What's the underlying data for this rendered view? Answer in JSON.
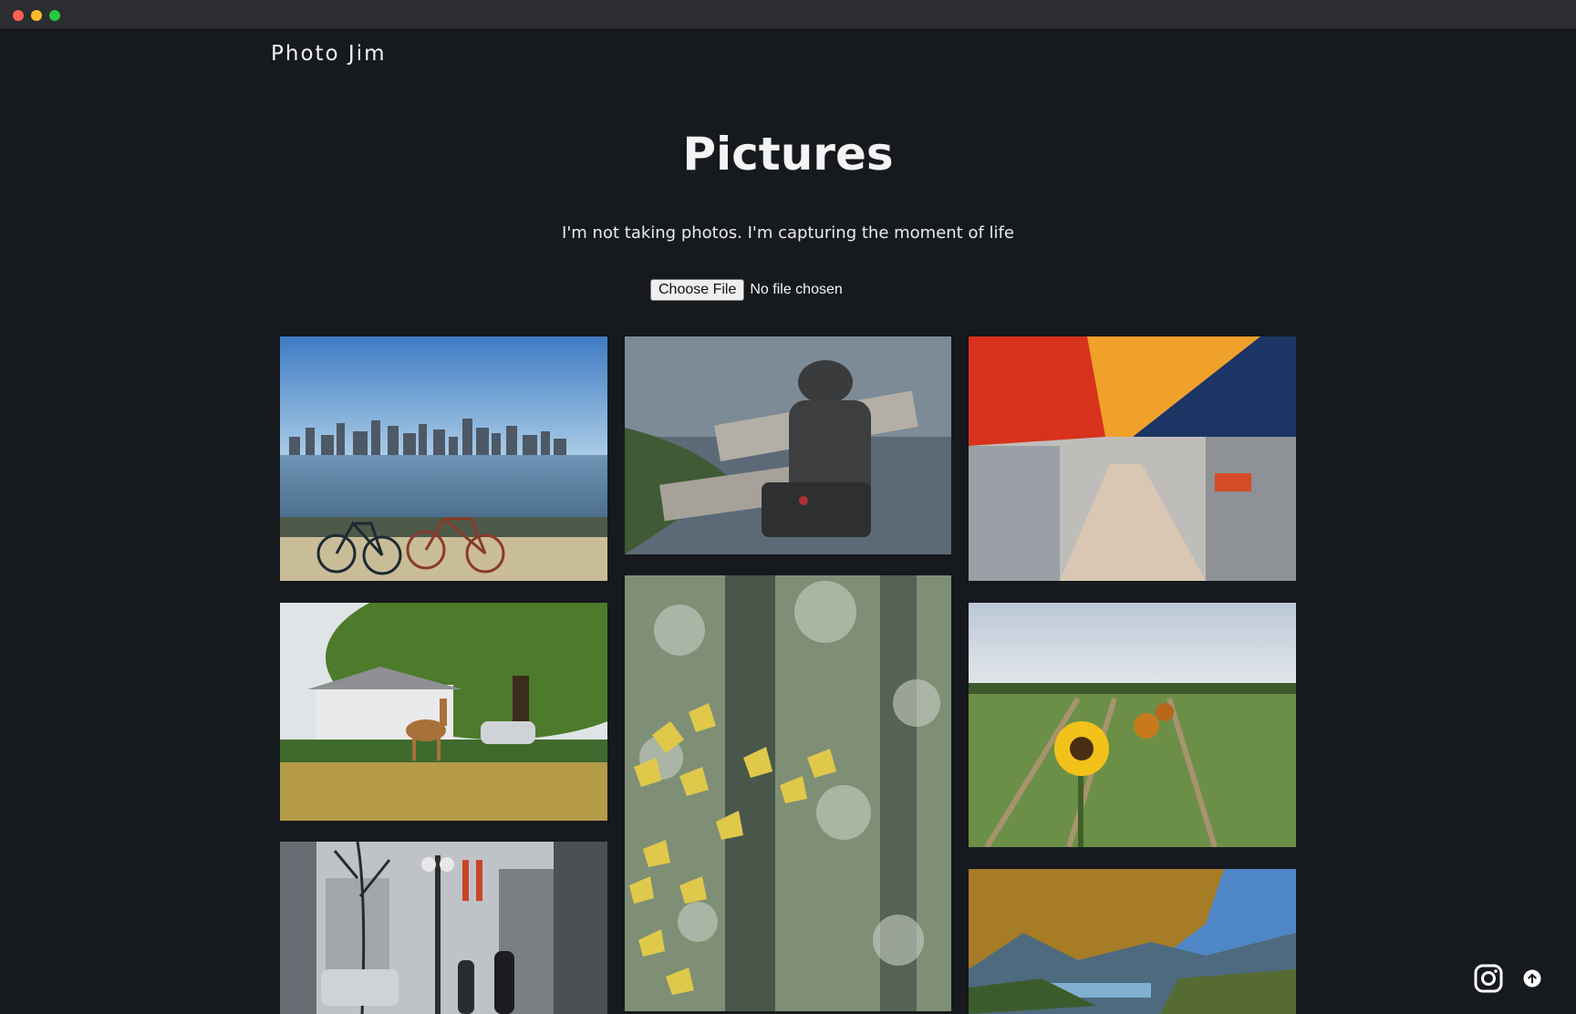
{
  "site": {
    "brand": "Photo Jim",
    "heading": "Pictures",
    "tagline": "I'm not taking photos. I'm capturing the moment of life"
  },
  "upload": {
    "button_label": "Choose File",
    "status": "No file chosen"
  },
  "gallery": {
    "photos": [
      {
        "subject": "city skyline across water with two bicycles"
      },
      {
        "subject": "bronze statue of man on bench by the sea"
      },
      {
        "subject": "market stalls under red, orange and blue canopies"
      },
      {
        "subject": "deer on grass under large tree"
      },
      {
        "subject": "yellow maple leaves in forest"
      },
      {
        "subject": "sunflower in green farm field"
      },
      {
        "subject": "city street with traffic lights and pedestrians"
      },
      {
        "subject": "mountains and water under canopy"
      }
    ]
  },
  "footer": {
    "icons": [
      "instagram-icon",
      "scroll-top-icon"
    ]
  }
}
